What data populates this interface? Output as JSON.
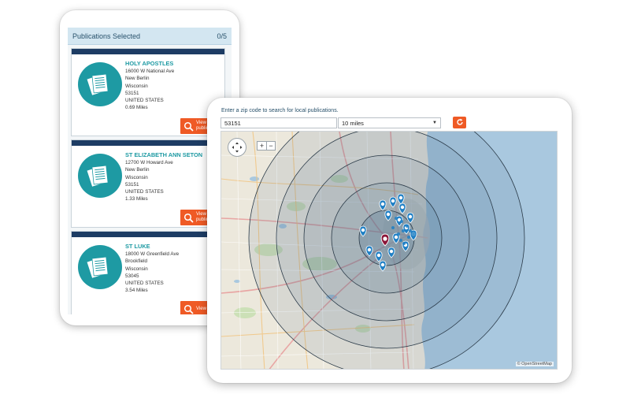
{
  "publications_panel": {
    "title": "Publications Selected",
    "count": "0/5",
    "items": [
      {
        "name": "HOLY APOSTLES",
        "street": "16000 W National Ave",
        "city": "New Berlin",
        "state": "Wisconsin",
        "zip": "53151",
        "country": "UNITED STATES",
        "distance": "0.69 Miles",
        "button_line1": "View",
        "button_line2": "public"
      },
      {
        "name": "ST ELIZABETH ANN SETON",
        "street": "12700 W Howard Ave",
        "city": "New Berlin",
        "state": "Wisconsin",
        "zip": "53151",
        "country": "UNITED STATES",
        "distance": "1.33 Miles",
        "button_line1": "View",
        "button_line2": "public"
      },
      {
        "name": "ST LUKE",
        "street": "18000 W Greenfield Ave",
        "city": "Brookfield",
        "state": "Wisconsin",
        "zip": "53045",
        "country": "UNITED STATES",
        "distance": "3.54 Miles",
        "button_line1": "View",
        "button_line2": ""
      }
    ]
  },
  "search": {
    "prompt": "Enter a zip code to search for local publications.",
    "zip_value": "53151",
    "radius_value": "10 miles"
  },
  "map": {
    "zoom_in": "+",
    "zoom_out": "−",
    "attribution": "© OpenStreetMap",
    "icons": {
      "pan": "pan-arrows-icon",
      "refresh": "refresh-icon",
      "publication": "newspaper-icon",
      "search": "magnifier-icon",
      "pin": "map-pin-icon",
      "center": "center-location-icon"
    }
  },
  "colors": {
    "accent_orange": "#ef5a25",
    "teal": "#1e9aa3",
    "navy": "#1d3c64",
    "pin_blue": "#1f7fc4",
    "center_pin": "#8b1538"
  }
}
